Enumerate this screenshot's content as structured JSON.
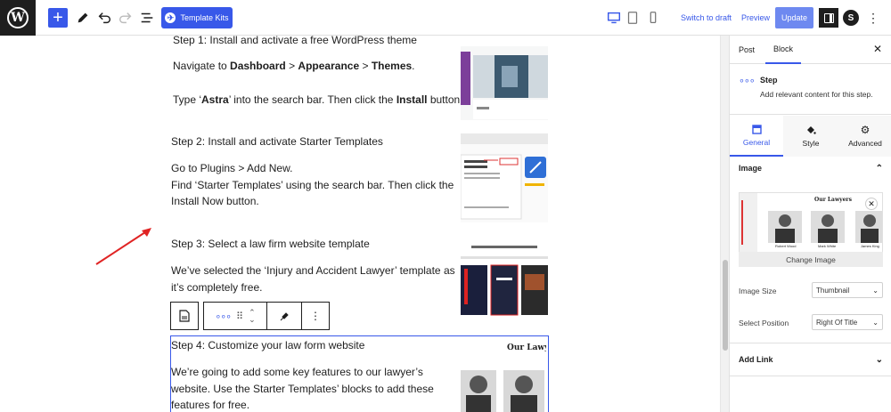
{
  "toolbar": {
    "template_kits_label": "Template Kits",
    "spectra_letter": "S",
    "switch_to_draft_label": "Switch to draft",
    "preview_label": "Preview",
    "update_label": "Update"
  },
  "content": {
    "step1": {
      "title": "Step 1: Install and activate a free WordPress theme",
      "nav_prefix": "Navigate to ",
      "nav_dashboard": "Dashboard",
      "nav_sep1": " > ",
      "nav_appearance": "Appearance",
      "nav_sep2": " > ",
      "nav_themes": "Themes",
      "nav_end": ".",
      "type_prefix": "Type ‘",
      "type_astra": "Astra",
      "type_mid": "’ into the search bar. Then click the ",
      "type_install": "Install",
      "type_end": " button."
    },
    "step2": {
      "title": "Step 2: Install and activate Starter Templates",
      "line1": "Go to Plugins > Add New.",
      "line2": "Find ‘Starter Templates’ using the search bar. Then click the",
      "line3": "Install Now button."
    },
    "step3": {
      "title": "Step 3: Select a law firm website template",
      "line1": "We’ve selected the ‘Injury and Accident Lawyer’ template as",
      "line2": "it’s completely free."
    },
    "step4": {
      "title": "Step 4: Customize your law form website",
      "line1": "We’re going to add some key features to our lawyer’s",
      "line2": "website. Use the Starter Templates’ blocks to add these",
      "line3": "features for free.",
      "image_heading": "Our Lawyers"
    }
  },
  "sidebar": {
    "tabs": {
      "post": "Post",
      "block": "Block"
    },
    "block_name": "Step",
    "block_description": "Add relevant content for this step.",
    "sub_tabs": {
      "general": "General",
      "style": "Style",
      "advanced": "Advanced"
    },
    "image_section_title": "Image",
    "preview_heading": "Our Lawyers",
    "preview_names": [
      "Robert Wood",
      "Mark White",
      "James King"
    ],
    "change_image_label": "Change Image",
    "image_size_label": "Image Size",
    "image_size_value": "Thumbnail",
    "select_position_label": "Select Position",
    "select_position_value": "Right Of Title",
    "add_link_label": "Add Link"
  }
}
